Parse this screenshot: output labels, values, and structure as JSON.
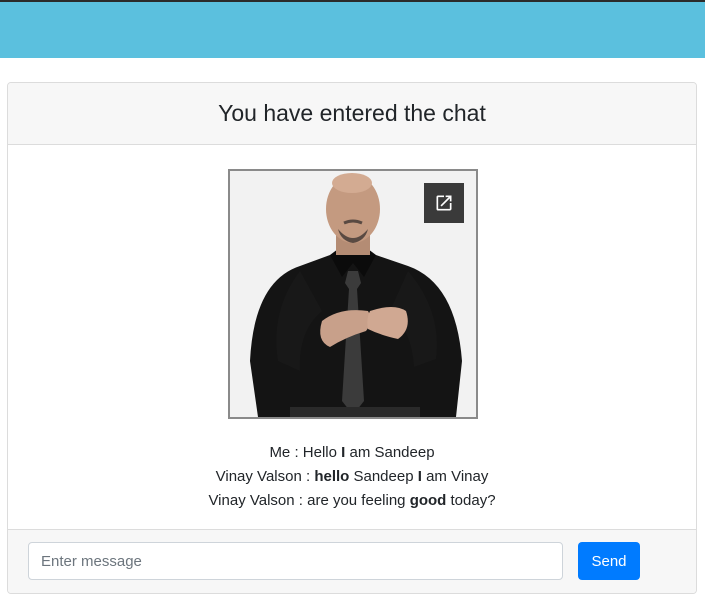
{
  "header": {
    "title": "You have entered the chat"
  },
  "video": {
    "popout_icon": "open-in-new-icon"
  },
  "messages": [
    {
      "parts": [
        {
          "text": "Me : Hello ",
          "bold": false
        },
        {
          "text": "I",
          "bold": true
        },
        {
          "text": " am Sandeep",
          "bold": false
        }
      ]
    },
    {
      "parts": [
        {
          "text": "Vinay Valson : ",
          "bold": false
        },
        {
          "text": "hello",
          "bold": true
        },
        {
          "text": " Sandeep ",
          "bold": false
        },
        {
          "text": "I",
          "bold": true
        },
        {
          "text": " am Vinay",
          "bold": false
        }
      ]
    },
    {
      "parts": [
        {
          "text": "Vinay Valson : are you feeling ",
          "bold": false
        },
        {
          "text": "good",
          "bold": true
        },
        {
          "text": " today?",
          "bold": false
        }
      ]
    }
  ],
  "composer": {
    "placeholder": "Enter message",
    "value": "",
    "send_label": "Send"
  },
  "colors": {
    "topbar": "#5bc0de",
    "send_button": "#007bff"
  }
}
